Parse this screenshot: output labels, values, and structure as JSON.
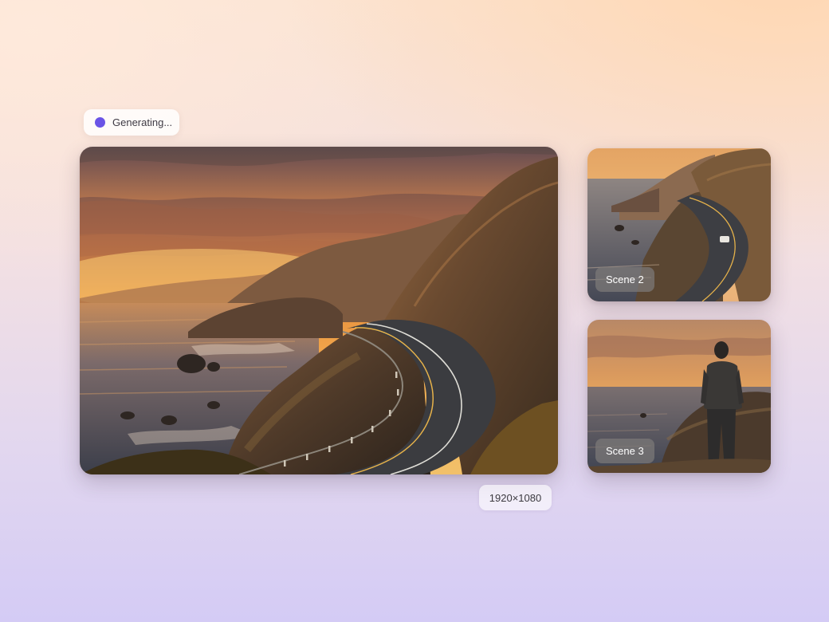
{
  "status": {
    "label": "Generating...",
    "dot_color": "#6a54e6",
    "icon": "status-dot-icon"
  },
  "main_image": {
    "description_icon": "main-scene-image",
    "resolution": "1920×1080"
  },
  "thumbnails": [
    {
      "label": "Scene 2"
    },
    {
      "label": "Scene 3"
    }
  ],
  "colors": {
    "accent": "#6a54e6",
    "sunset_orange": "#f0a14a",
    "ocean": "#4a5a6e"
  }
}
